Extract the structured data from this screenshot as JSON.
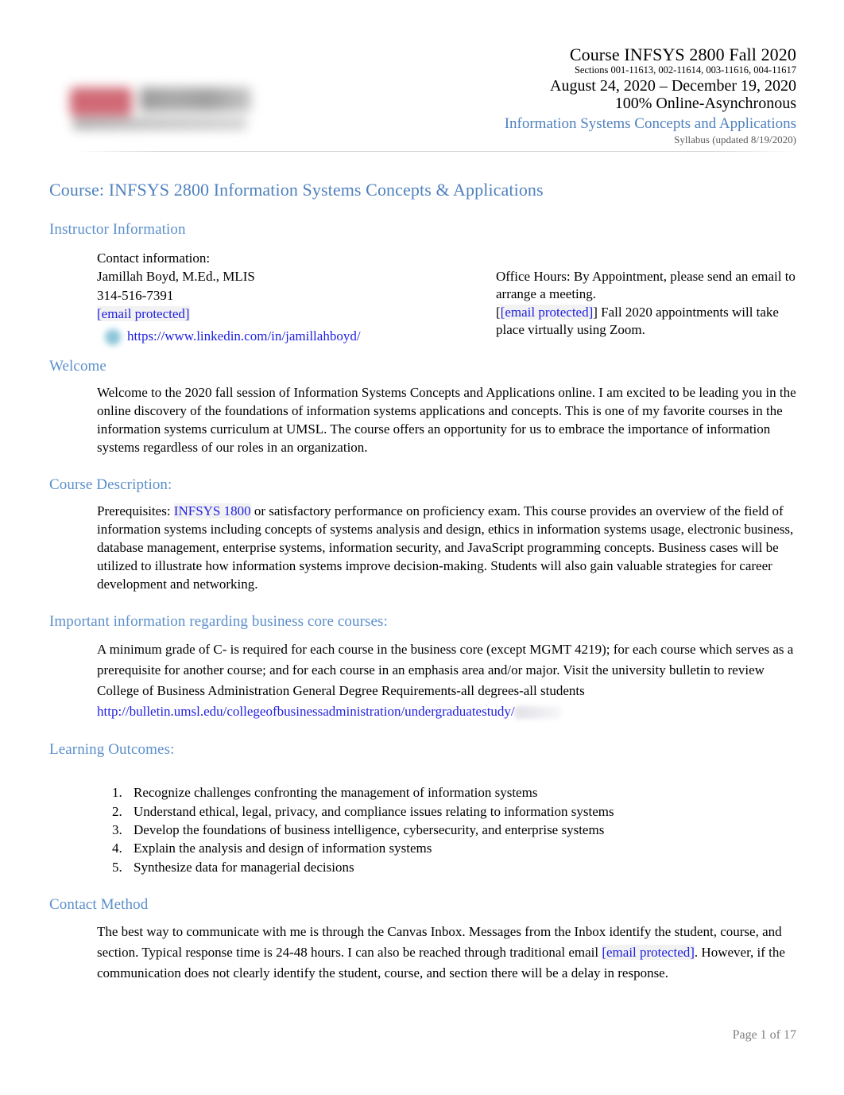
{
  "header": {
    "course_line": "Course INFSYS 2800 Fall 2020",
    "sections_line": "Sections 001-11613, 002-11614, 003-11616, 004-11617",
    "dates_line": "August 24, 2020 – December 19, 2020",
    "mode_line": "100% Online-Asynchronous",
    "subject_line": "Information Systems Concepts and Applications",
    "syllabus_line": "Syllabus  (updated 8/19/2020)",
    "logo_alt": "university-logo-blurred"
  },
  "doc_title": "Course: INFSYS 2800 Information Systems Concepts & Applications",
  "sections": {
    "instructor": {
      "heading": "Instructor Information",
      "contact_label": "Contact information:",
      "name": "Jamillah Boyd, M.Ed., MLIS",
      "phone": "314-516-7391",
      "email": "[email protected]",
      "linkedin": "https://www.linkedin.com/in/jamillahboyd/",
      "office_hours_line1": "Office Hours: By Appointment, please send an email to arrange a meeting.",
      "office_email_open": "[",
      "office_email": "[email protected]",
      "office_email_close": "]",
      "office_hours_line2": " Fall 2020 appointments will take place virtually using Zoom."
    },
    "welcome": {
      "heading": "Welcome",
      "body": "Welcome to the 2020 fall session of Information Systems Concepts and Applications online. I am excited to be leading you in the online discovery of the foundations of information systems applications and concepts. This is one of my favorite courses in the information systems curriculum at UMSL. The course offers an opportunity for us to embrace the importance of information systems regardless of our roles in an organization."
    },
    "course_description": {
      "heading": "Course Description:",
      "prefix": "Prerequisites: ",
      "prereq_link": "INFSYS 1800",
      "body": " or satisfactory performance on proficiency exam. This course provides an overview of the field of information systems including concepts of systems analysis and design, ethics in information systems usage, electronic business, database management, enterprise systems, information security, and JavaScript programming concepts. Business cases will be utilized to illustrate how information systems improve decision-making. Students will also gain valuable strategies for career development and networking."
    },
    "business_core": {
      "heading": "Important information regarding business core courses:",
      "body": " A minimum grade of C- is required for each course in the business core (except MGMT 4219); for each course which serves as a prerequisite for another course; and for each course in an emphasis area and/or major. Visit the university bulletin to review College of Business Administration  General Degree Requirements-all degrees-all students  ",
      "bulletin_link": "http://bulletin.umsl.edu/collegeofbusinessadministration/undergraduatestudy/"
    },
    "learning_outcomes": {
      "heading": "Learning Outcomes:",
      "items": [
        "Recognize challenges confronting the management of information systems",
        "Understand ethical, legal, privacy, and compliance issues relating to information systems",
        "Develop the foundations of business intelligence, cybersecurity, and enterprise systems",
        "Explain the analysis and design of information systems",
        "Synthesize data for managerial decisions"
      ]
    },
    "contact_method": {
      "heading": "Contact Method",
      "body_part1": "The best way to communicate with me is through the Canvas Inbox. Messages from the Inbox identify the student, course, and section. Typical response time is 24-48 hours. I can also be reached through traditional email ",
      "email": "[email protected]",
      "body_part2": ". However, if the communication does not clearly identify the student, course, and section there will be a delay in response."
    }
  },
  "footer": {
    "page_label": "Page 1 of 17"
  },
  "colors": {
    "heading_blue": "#5b8fcb",
    "title_blue": "#4f81bd",
    "link_blue": "#2020e0",
    "footer_gray": "#808080"
  }
}
